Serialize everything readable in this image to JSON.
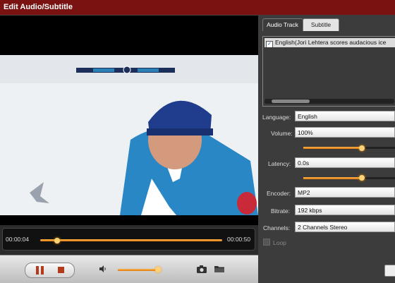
{
  "window": {
    "title": "Edit Audio/Subtitle"
  },
  "player": {
    "current_time": "00:00:04",
    "total_time": "00:00:50",
    "progress_fraction": 0.08,
    "volume_fraction": 0.95
  },
  "tabs": [
    {
      "label": "Audio Track",
      "active": true
    },
    {
      "label": "Subtitle",
      "active": false
    }
  ],
  "audio_tracks": [
    {
      "label": "English(Jori Lehtera scores audacious ice",
      "checked": true
    }
  ],
  "settings": {
    "language": {
      "label": "Language:",
      "value": "English"
    },
    "volume": {
      "label": "Volume:",
      "value": "100%",
      "slider_fraction": 0.64
    },
    "latency": {
      "label": "Latency:",
      "value": "0.0s",
      "slider_fraction": 0.64
    },
    "encoder": {
      "label": "Encoder:",
      "value": "MP2"
    },
    "bitrate": {
      "label": "Bitrate:",
      "value": "192 kbps"
    },
    "channels": {
      "label": "Channels:",
      "value": "2 Channels Stereo"
    },
    "loop": {
      "label": "Loop",
      "checked": false
    }
  },
  "colors": {
    "title_bar": "#7a1212",
    "accent": "#f29a1f"
  }
}
